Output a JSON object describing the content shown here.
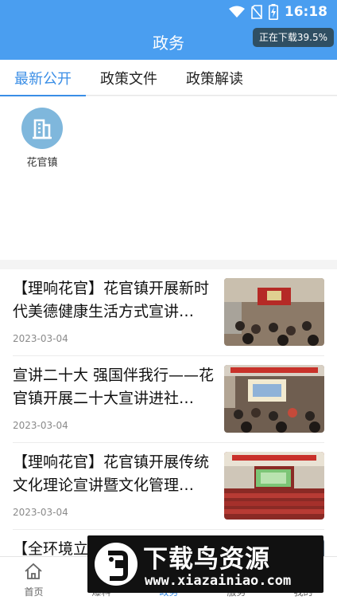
{
  "status_bar": {
    "time": "16:18"
  },
  "header": {
    "title": "政务",
    "download_badge": "正在下载39.5%"
  },
  "tabs": [
    {
      "label": "最新公开",
      "active": true
    },
    {
      "label": "政策文件",
      "active": false
    },
    {
      "label": "政策解读",
      "active": false
    }
  ],
  "orgs": [
    {
      "name": "花官镇"
    }
  ],
  "news": [
    {
      "title": "【理响花官】花官镇开展新时代美德健康生活方式宣讲…",
      "date": "2023-03-04"
    },
    {
      "title": "宣讲二十大 强国伴我行——花官镇开展二十大宣讲进社…",
      "date": "2023-03-04"
    },
    {
      "title": "【理响花官】花官镇开展传统文化理论宣讲暨文化管理…",
      "date": "2023-03-04"
    },
    {
      "title": "【全环境立",
      "date": ""
    }
  ],
  "bottom_nav": [
    {
      "label": "首页",
      "icon": "home-icon",
      "active": false
    },
    {
      "label": "爆料",
      "icon": "report-icon",
      "active": false
    },
    {
      "label": "政务",
      "icon": "government-icon",
      "active": true
    },
    {
      "label": "服务",
      "icon": "service-icon",
      "active": false
    },
    {
      "label": "我的",
      "icon": "profile-icon",
      "active": false
    }
  ],
  "watermark": {
    "text": "下载鸟资源",
    "url": "www.xiazainiao.com"
  },
  "colors": {
    "primary": "#4a9ef0",
    "tab_active": "#3a8ee6",
    "badge_bg": "#2f4f63"
  }
}
